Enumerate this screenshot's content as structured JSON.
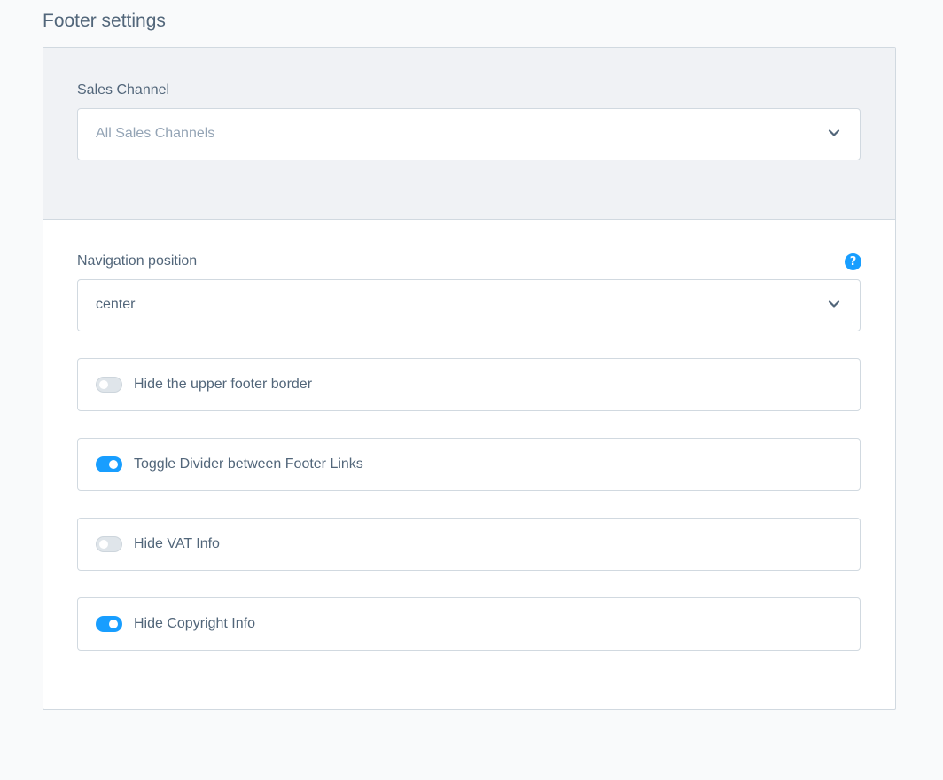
{
  "page": {
    "title": "Footer settings"
  },
  "sales_channel": {
    "label": "Sales Channel",
    "placeholder": "All Sales Channels",
    "icon": "chevron-down-icon"
  },
  "navigation_position": {
    "label": "Navigation position",
    "value": "center",
    "help_icon_glyph": "?",
    "icon": "chevron-down-icon"
  },
  "toggles": [
    {
      "label": "Hide the upper footer border",
      "on": false
    },
    {
      "label": "Toggle Divider between Footer Links",
      "on": true
    },
    {
      "label": "Hide VAT Info",
      "on": false
    },
    {
      "label": "Hide Copyright Info",
      "on": true
    }
  ],
  "colors": {
    "accent": "#189eff",
    "text": "#52667a",
    "placeholder": "#94a4b5",
    "border": "#d1d9e0",
    "header_bg": "#f0f2f5",
    "page_bg": "#f9fafb"
  }
}
